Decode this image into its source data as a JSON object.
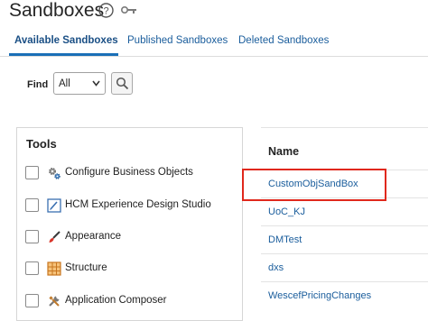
{
  "header": {
    "title": "Sandboxes",
    "help_icon": "help-icon",
    "key_icon": "key-icon"
  },
  "tabs": [
    {
      "label": "Available Sandboxes",
      "active": true
    },
    {
      "label": "Published Sandboxes",
      "active": false
    },
    {
      "label": "Deleted Sandboxes",
      "active": false
    }
  ],
  "find": {
    "label": "Find",
    "selected": "All",
    "search_icon": "search-icon"
  },
  "tools": {
    "title": "Tools",
    "items": [
      {
        "label": "Configure Business Objects",
        "icon": "gears-icon",
        "checked": false
      },
      {
        "label": "HCM Experience Design Studio",
        "icon": "design-studio-icon",
        "checked": false
      },
      {
        "label": "Appearance",
        "icon": "paintbrush-icon",
        "checked": false
      },
      {
        "label": "Structure",
        "icon": "structure-grid-icon",
        "checked": false
      },
      {
        "label": "Application Composer",
        "icon": "tools-icon",
        "checked": false
      }
    ]
  },
  "sandboxes": {
    "column_header": "Name",
    "rows": [
      {
        "name": "CustomObjSandBox",
        "highlighted": true
      },
      {
        "name": "UoC_KJ"
      },
      {
        "name": "DMTest"
      },
      {
        "name": "dxs"
      },
      {
        "name": "WescefPricingChanges"
      }
    ]
  },
  "colors": {
    "link": "#1a5d9c",
    "tab_underline": "#1a6fb7",
    "highlight": "#e0281c"
  }
}
